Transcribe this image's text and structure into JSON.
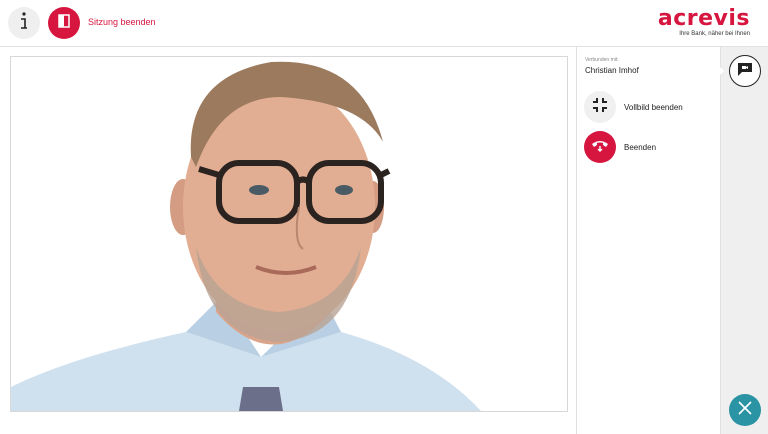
{
  "header": {
    "info_icon": "info-icon",
    "end_session_label": "Sitzung beenden",
    "end_session_icon": "door-exit-icon",
    "logo_text": "acrevis",
    "logo_tagline": "Ihre Bank, näher bei Ihnen"
  },
  "video": {
    "content": "Video-Stream"
  },
  "sidebar": {
    "connected_label": "Verbunden mit:",
    "connected_name": "Christian Imhof",
    "actions": [
      {
        "label": "Vollbild beenden",
        "icon": "exit-fullscreen-icon"
      },
      {
        "label": "Beenden",
        "icon": "hang-up-icon"
      }
    ]
  },
  "rail": {
    "video_chat_icon": "video-chat-icon",
    "close_icon": "close-icon"
  },
  "colors": {
    "brand": "#d6163f",
    "accent": "#2a93a4",
    "rail_bg": "#efefef"
  }
}
